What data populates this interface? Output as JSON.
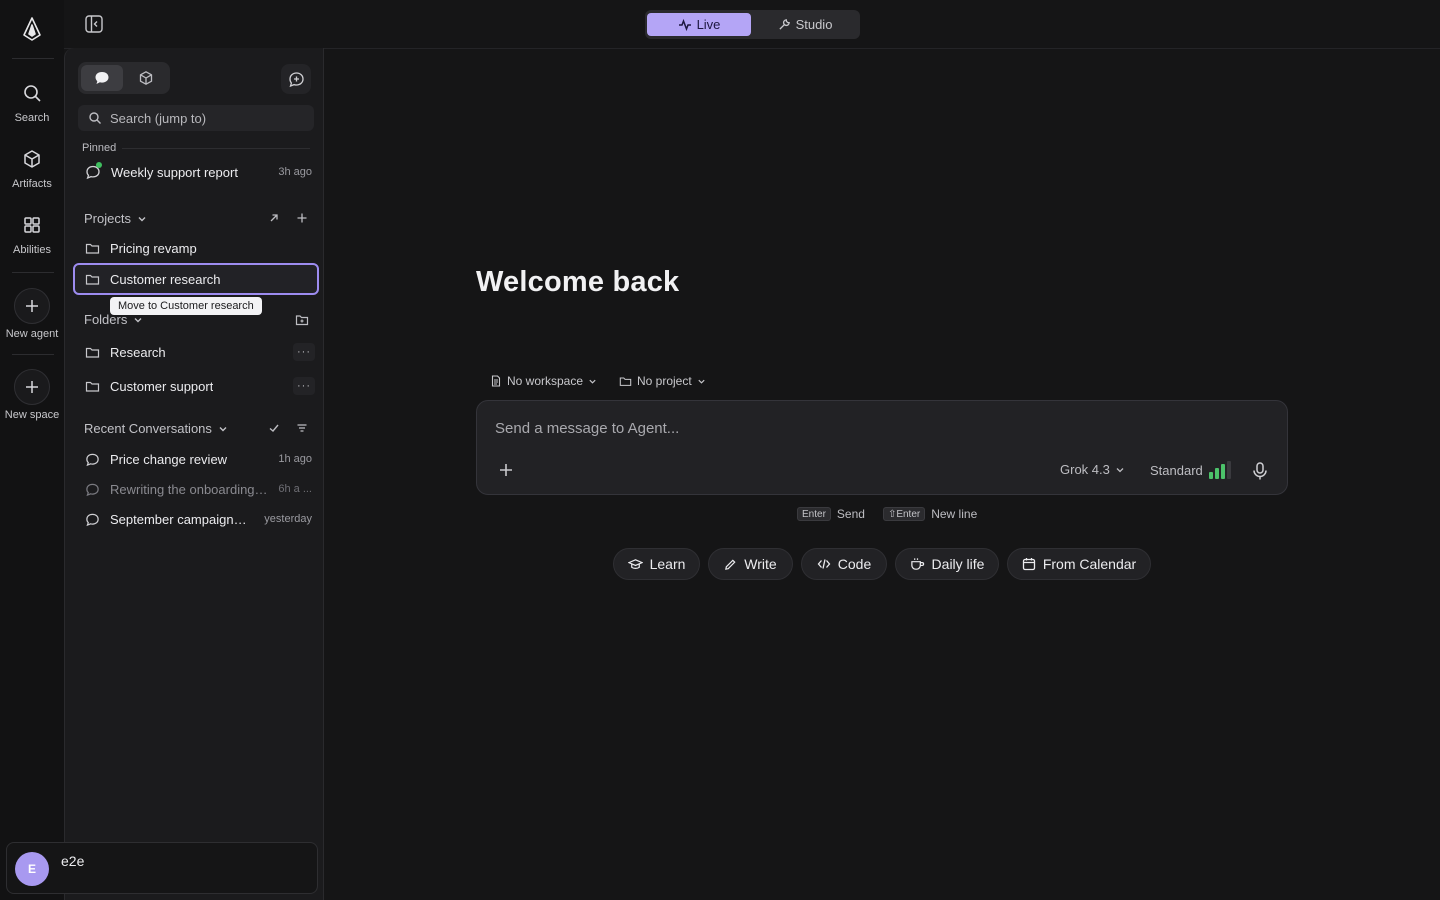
{
  "rail": {
    "items": [
      {
        "label": "Search",
        "icon": "search-icon"
      },
      {
        "label": "Artifacts",
        "icon": "cube-icon"
      },
      {
        "label": "Abilities",
        "icon": "grid-icon"
      },
      {
        "label": "New agent",
        "icon": "plus-icon"
      },
      {
        "label": "New space",
        "icon": "plus-icon"
      }
    ]
  },
  "topbar": {
    "modes": [
      {
        "label": "Live",
        "icon": "activity-icon",
        "active": true
      },
      {
        "label": "Studio",
        "icon": "wrench-icon",
        "active": false
      }
    ]
  },
  "sidebar": {
    "search_placeholder": "Search (jump to)",
    "pinned": {
      "heading": "Pinned",
      "items": [
        {
          "title": "Weekly support report",
          "time": "3h ago"
        }
      ]
    },
    "projects": {
      "heading": "Projects",
      "items": [
        {
          "title": "Pricing revamp"
        },
        {
          "title": "Customer research",
          "selected": true
        }
      ]
    },
    "tooltip": "Move to Customer research",
    "folders": {
      "heading": "Folders",
      "items": [
        {
          "title": "Research"
        },
        {
          "title": "Customer support"
        }
      ]
    },
    "recent": {
      "heading": "Recent Conversations",
      "items": [
        {
          "title": "Price change review",
          "time": "1h ago"
        },
        {
          "title": "Rewriting the onboarding ...",
          "time": "6h a ..."
        },
        {
          "title": "September campaign i...",
          "time": "yesterday"
        }
      ]
    },
    "user": {
      "initial": "E",
      "name": "e2e"
    }
  },
  "main": {
    "welcome": "Welcome back",
    "workspace_label": "No workspace",
    "project_label": "No project",
    "composer_placeholder": "Send a message to Agent...",
    "model": "Grok 4.3",
    "effort": "Standard",
    "hints": {
      "send_key": "Enter",
      "send": "Send",
      "newline_key": "⇧Enter",
      "newline": "New line"
    },
    "chips": [
      {
        "label": "Learn",
        "icon": "graduation-cap-icon"
      },
      {
        "label": "Write",
        "icon": "pencil-icon"
      },
      {
        "label": "Code",
        "icon": "code-icon"
      },
      {
        "label": "Daily life",
        "icon": "coffee-icon"
      },
      {
        "label": "From Calendar",
        "icon": "calendar-icon"
      }
    ]
  },
  "colors": {
    "accent": "#b4a5f6",
    "online": "#3fbf5f",
    "signal": "#4cc26a"
  }
}
